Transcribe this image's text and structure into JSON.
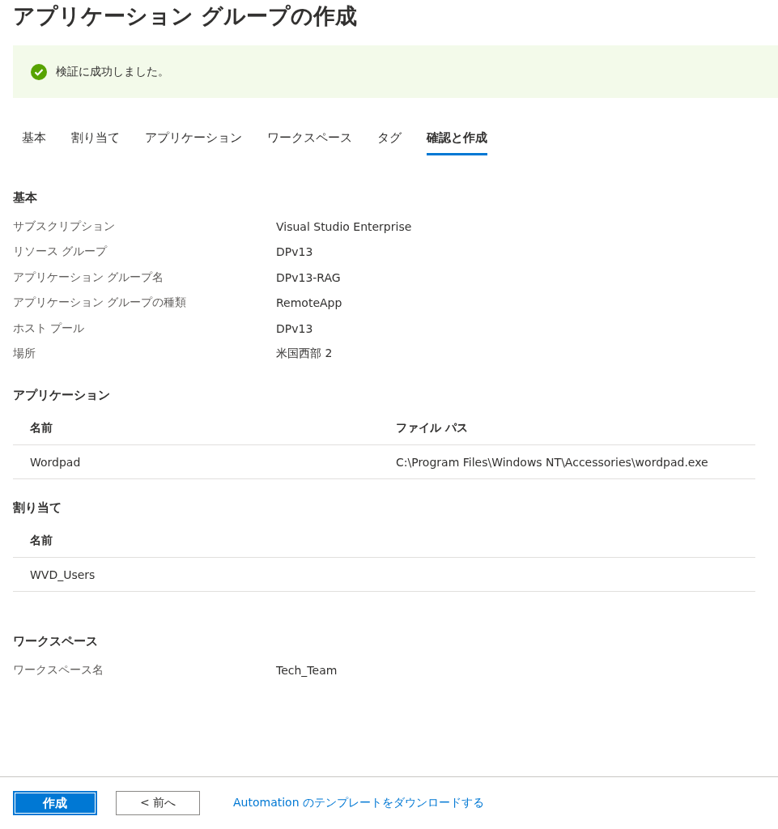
{
  "title": "アプリケーション グループの作成",
  "banner": {
    "kind": "success",
    "message": "検証に成功しました。"
  },
  "tabs": [
    {
      "label": "基本",
      "selected": false
    },
    {
      "label": "割り当て",
      "selected": false
    },
    {
      "label": "アプリケーション",
      "selected": false
    },
    {
      "label": "ワークスペース",
      "selected": false
    },
    {
      "label": "タグ",
      "selected": false
    },
    {
      "label": "確認と作成",
      "selected": true
    }
  ],
  "sections": [
    {
      "kind": "fields",
      "heading": "基本",
      "fields": [
        {
          "label": "サブスクリプション",
          "value": "Visual Studio Enterprise"
        },
        {
          "label": "リソース グループ",
          "value": "DPv13"
        },
        {
          "label": "アプリケーション グループ名",
          "value": "DPv13-RAG"
        },
        {
          "label": "アプリケーション グループの種類",
          "value": "RemoteApp"
        },
        {
          "label": "ホスト プール",
          "value": "DPv13"
        },
        {
          "label": "場所",
          "value": "米国西部 2"
        }
      ]
    },
    {
      "kind": "table",
      "heading": "アプリケーション",
      "columns": [
        "名前",
        "ファイル パス"
      ],
      "rows": [
        [
          "Wordpad",
          "C:\\Program Files\\Windows NT\\Accessories\\wordpad.exe"
        ]
      ]
    },
    {
      "kind": "table",
      "heading": "割り当て",
      "columns": [
        "名前"
      ],
      "rows": [
        [
          "WVD_Users"
        ]
      ]
    },
    {
      "kind": "fields",
      "heading": "ワークスペース",
      "fields": [
        {
          "label": "ワークスペース名",
          "value": "Tech_Team"
        }
      ]
    }
  ],
  "footer": {
    "primary": "作成",
    "secondary": "< 前へ",
    "link": "Automation のテンプレートをダウンロードする"
  }
}
